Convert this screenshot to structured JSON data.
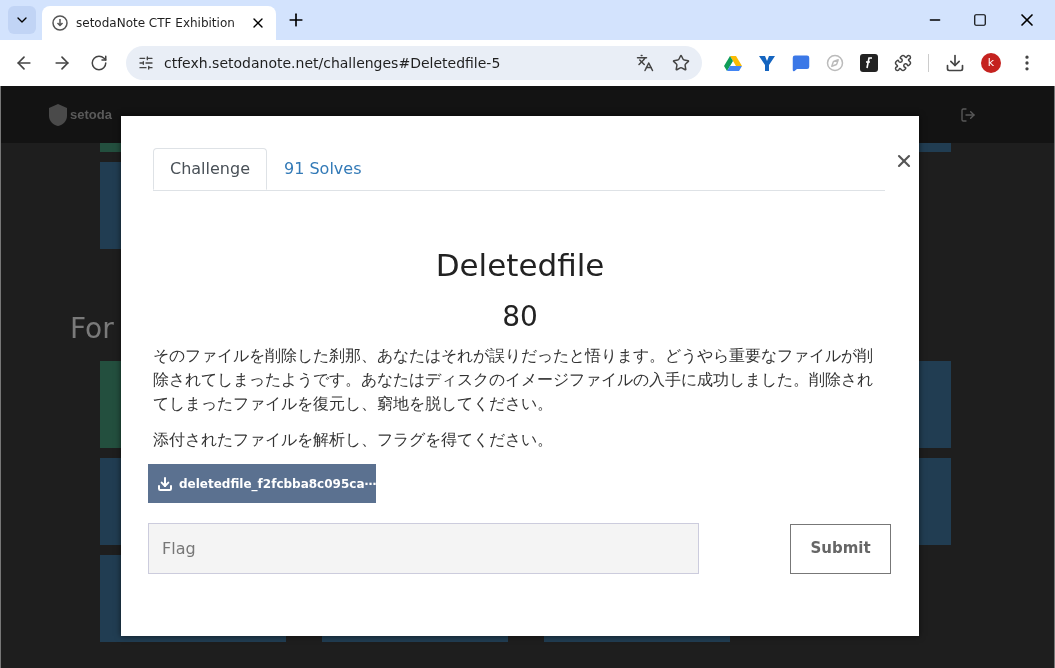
{
  "browser": {
    "tab_title": "setodaNote CTF Exhibition",
    "url": "ctfexh.setodanote.net/challenges#Deletedfile-5",
    "profile_initial": "k"
  },
  "navbar": {
    "brand": "setoda"
  },
  "challenge_board": [
    {
      "rows": [
        [
          {
            "solved": true
          },
          null,
          null,
          {
            "solved": false
          }
        ],
        [
          {
            "solved": false
          }
        ]
      ]
    },
    {
      "heading": "For",
      "rows": [
        [
          {
            "solved": true
          },
          null,
          null,
          {
            "solved": false
          }
        ],
        [
          {
            "solved": false
          },
          null,
          null,
          {
            "solved": false
          }
        ],
        [
          {
            "solved": false
          },
          {
            "solved": false
          },
          {
            "solved": false
          }
        ]
      ]
    }
  ],
  "modal": {
    "tabs": [
      {
        "label": "Challenge",
        "selected": true
      },
      {
        "label": "91 Solves",
        "selected": false
      }
    ],
    "title": "Deletedfile",
    "points": "80",
    "description": [
      "そのファイルを削除した刹那、あなたはそれが誤りだったと悟ります。どうやら重要なファイルが削除されてしまったようです。あなたはディスクのイメージファイルの入手に成功しました。削除されてしまったファイルを復元し、窮地を脱してください。",
      "添付されたファイルを解析し、フラグを得てください。"
    ],
    "file": "deletedfile_f2fcbba8c095ca⋯",
    "flag_placeholder": "Flag",
    "submit": "Submit"
  }
}
